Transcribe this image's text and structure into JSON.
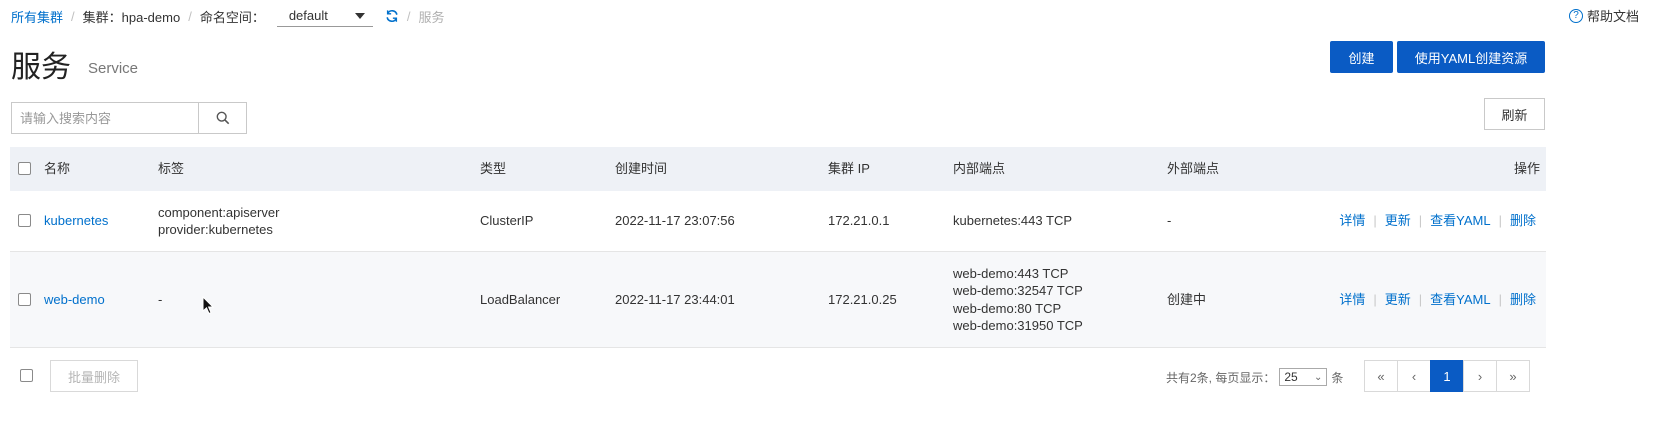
{
  "breadcrumb": {
    "all_clusters": "所有集群",
    "cluster_label": "集群：hpa-demo",
    "namespace_label": "命名空间：",
    "namespace_value": "default",
    "current": "服务"
  },
  "help": {
    "label": "帮助文档"
  },
  "page": {
    "title": "服务",
    "subtitle": "Service"
  },
  "actions": {
    "create": "创建",
    "create_yaml": "使用YAML创建资源",
    "refresh": "刷新"
  },
  "search": {
    "placeholder": "请输入搜索内容",
    "value": ""
  },
  "table": {
    "headers": {
      "name": "名称",
      "labels": "标签",
      "type": "类型",
      "created": "创建时间",
      "cluster_ip": "集群 IP",
      "internal": "内部端点",
      "external": "外部端点",
      "ops": "操作"
    },
    "rows": [
      {
        "name": "kubernetes",
        "labels": [
          "component:apiserver",
          "provider:kubernetes"
        ],
        "type": "ClusterIP",
        "created": "2022-11-17 23:07:56",
        "cluster_ip": "172.21.0.1",
        "internal": [
          "kubernetes:443 TCP"
        ],
        "external": "-"
      },
      {
        "name": "web-demo",
        "labels": [
          "-"
        ],
        "type": "LoadBalancer",
        "created": "2022-11-17 23:44:01",
        "cluster_ip": "172.21.0.25",
        "internal": [
          "web-demo:443 TCP",
          "web-demo:32547 TCP",
          "web-demo:80 TCP",
          "web-demo:31950 TCP"
        ],
        "external": "创建中"
      }
    ],
    "row_ops": {
      "detail": "详情",
      "update": "更新",
      "view_yaml": "查看YAML",
      "delete": "删除"
    }
  },
  "footer": {
    "batch_delete": "批量删除",
    "total_text": "共有2条, 每页显示：",
    "page_size": "25",
    "unit": "条",
    "pages": {
      "first": "«",
      "prev": "‹",
      "current": "1",
      "next": "›",
      "last": "»"
    }
  },
  "colors": {
    "primary": "#0a5bc4",
    "link": "#0070cc",
    "header_bg": "#eef1f6"
  }
}
